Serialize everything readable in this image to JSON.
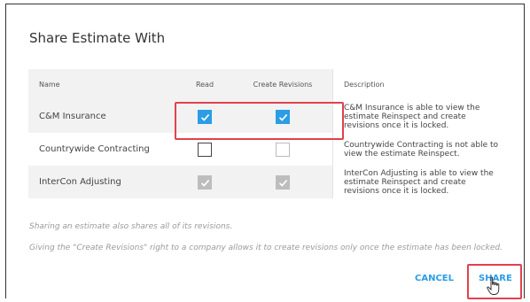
{
  "dialog": {
    "title": "Share Estimate With"
  },
  "table": {
    "headers": {
      "name": "Name",
      "read": "Read",
      "create_revisions": "Create Revisions",
      "description": "Description"
    },
    "rows": [
      {
        "name": "C&M Insurance",
        "read": "checked",
        "create_revisions": "checked",
        "description": "C&M Insurance is able to view the estimate Reinspect and create revisions once it is locked."
      },
      {
        "name": "Countrywide Contracting",
        "read": "unchecked",
        "create_revisions": "unchecked-disabled",
        "description": "Countrywide Contracting is not able to view the estimate Reinspect."
      },
      {
        "name": "InterCon Adjusting",
        "read": "checked-disabled",
        "create_revisions": "checked-disabled",
        "description": "InterCon Adjusting is able to view the estimate Reinspect and create revisions once it is locked."
      }
    ]
  },
  "notes": {
    "line1": "Sharing an estimate also shares all of its revisions.",
    "line2": "Giving the \"Create Revisions\" right to a company allows it to create revisions only once the estimate has been locked."
  },
  "buttons": {
    "cancel": "CANCEL",
    "share": "SHARE"
  },
  "colors": {
    "accent": "#2a9de5",
    "highlight": "#e0424d",
    "disabled": "#bdbdbd"
  }
}
